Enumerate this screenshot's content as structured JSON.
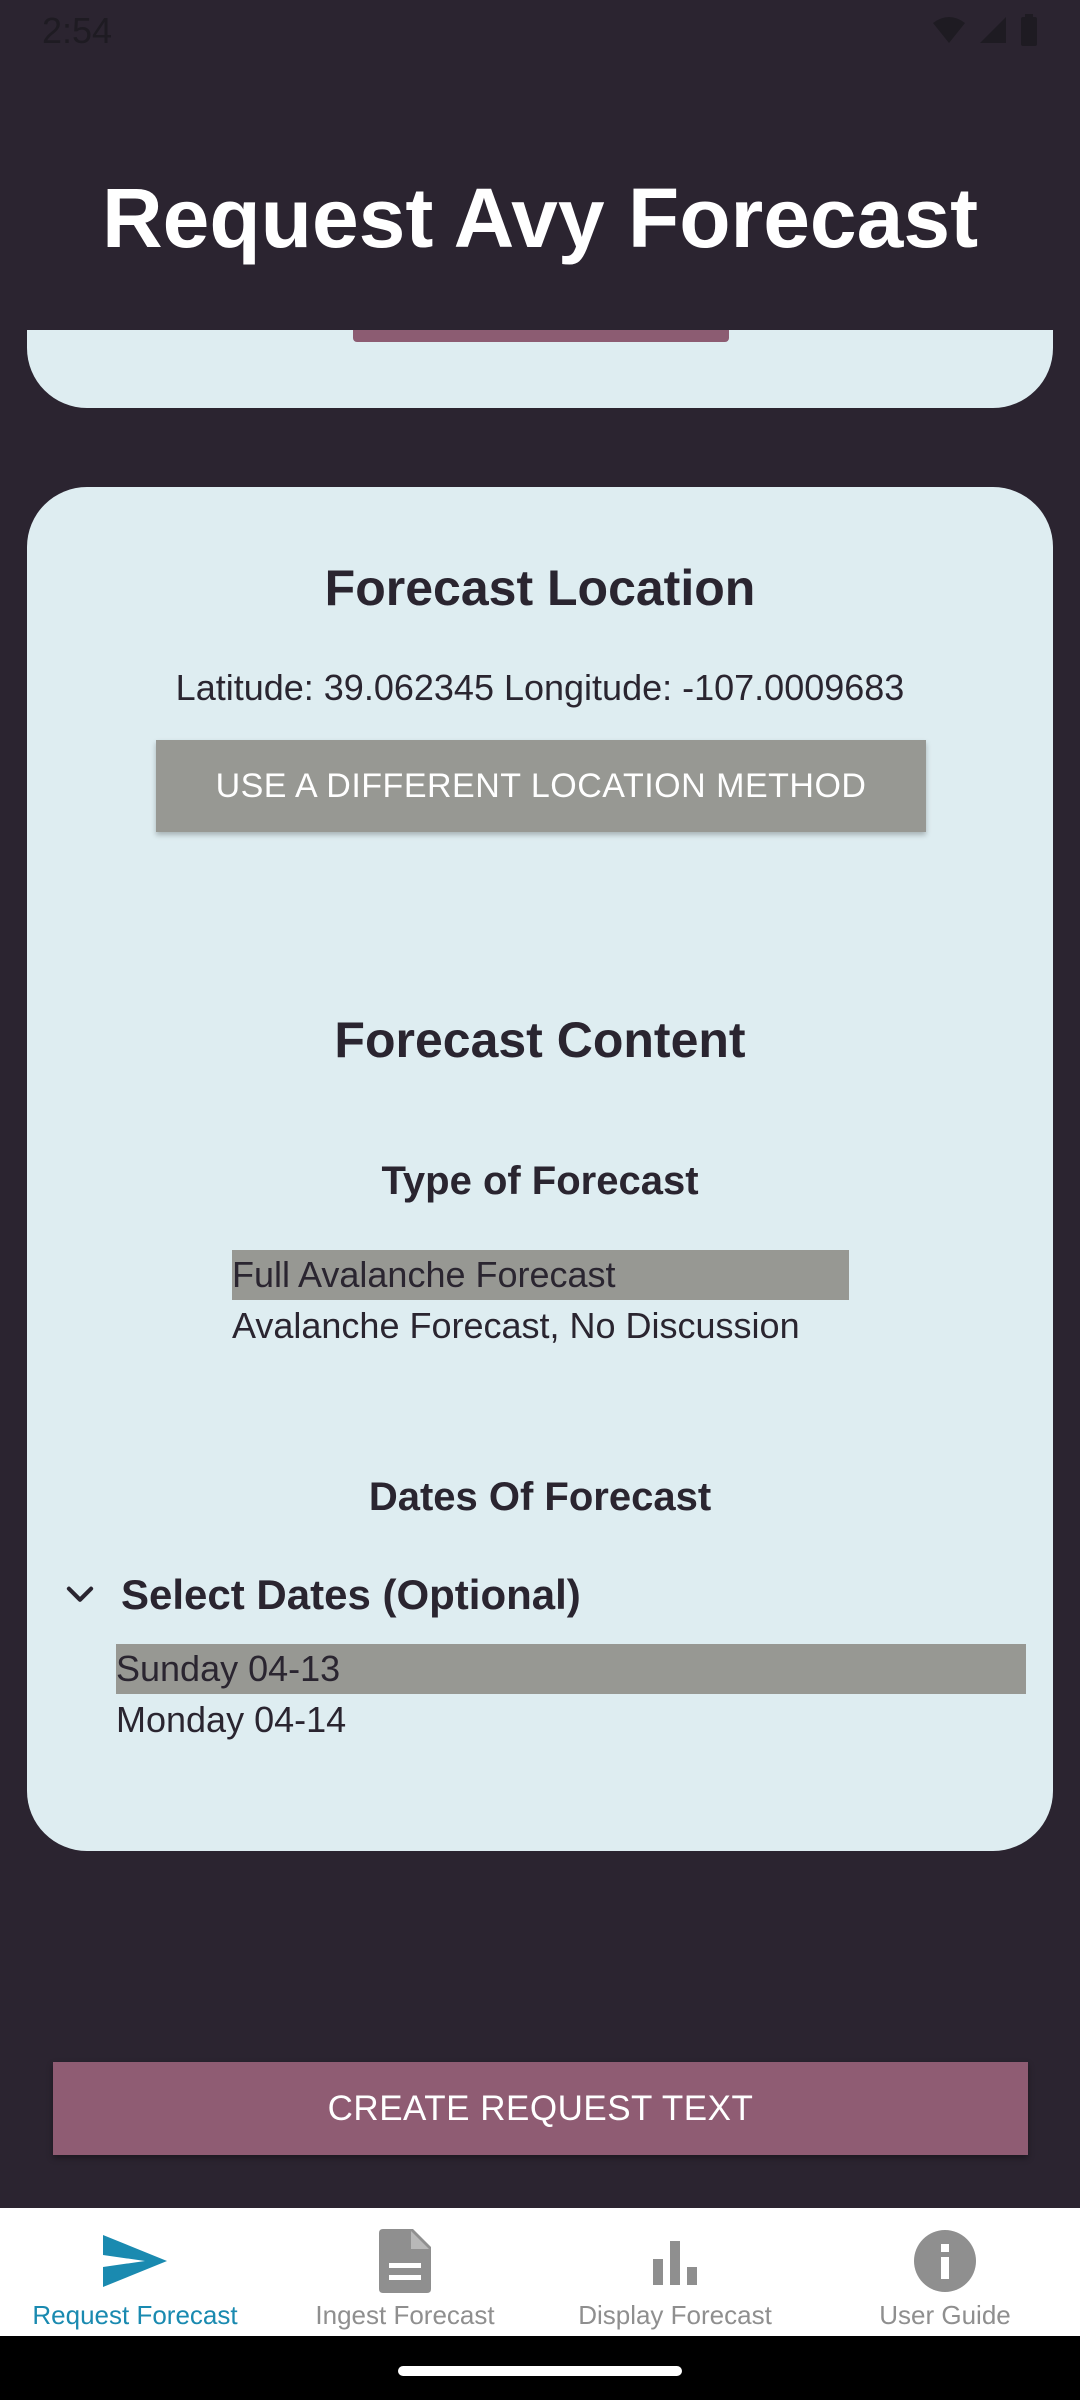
{
  "status_bar": {
    "time": "2:54"
  },
  "header": {
    "title": "Request Avy Forecast"
  },
  "location_card": {
    "title": "Forecast Location",
    "coordinates": "Latitude: 39.062345 Longitude: -107.0009683",
    "change_method_button": "USE A DIFFERENT LOCATION METHOD"
  },
  "content_section": {
    "title": "Forecast Content",
    "type_label": "Type of Forecast",
    "forecast_types": [
      {
        "label": "Full Avalanche Forecast",
        "selected": true
      },
      {
        "label": "Avalanche Forecast, No Discussion",
        "selected": false
      }
    ],
    "dates_label": "Dates Of Forecast",
    "dates_expander": "Select Dates (Optional)",
    "dates": [
      {
        "label": "Sunday 04-13",
        "selected": true
      },
      {
        "label": "Monday 04-14",
        "selected": false
      }
    ]
  },
  "create_button": "CREATE REQUEST TEXT",
  "bottom_nav": {
    "items": [
      {
        "label": "Request Forecast",
        "icon": "send-icon",
        "active": true
      },
      {
        "label": "Ingest Forecast",
        "icon": "document-icon",
        "active": false
      },
      {
        "label": "Display Forecast",
        "icon": "bar-chart-icon",
        "active": false
      },
      {
        "label": "User Guide",
        "icon": "info-icon",
        "active": false
      }
    ]
  },
  "colors": {
    "background": "#2b2430",
    "card": "#deedf1",
    "accent_button": "#8f5c73",
    "neutral_button": "#979893",
    "active_nav": "#1a8ab0",
    "inactive_nav": "#8f8f8f"
  }
}
